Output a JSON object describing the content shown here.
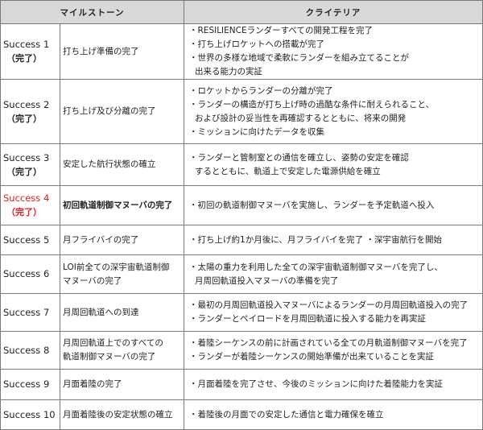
{
  "headers": {
    "milestone": "マイルストーン",
    "criteria": "クライテリア"
  },
  "accent_color": "#e0201b",
  "rows": [
    {
      "id": "Success 1",
      "status": "（完了）",
      "highlight": false,
      "name": [
        "打ち上げ準備の完了"
      ],
      "criteria": [
        {
          "text": "・RESILIENCEランダーすべての開発工程を完了",
          "cont": false
        },
        {
          "text": "・打ち上げロケットへの搭載が完了",
          "cont": false
        },
        {
          "text": "・世界の多様な地域で柔軟にランダーを組み立てることが",
          "cont": false
        },
        {
          "text": "出来る能力の実証",
          "cont": true
        }
      ]
    },
    {
      "id": "Success 2",
      "status": "（完了）",
      "highlight": false,
      "name": [
        "打ち上げ及び分離の完了"
      ],
      "criteria": [
        {
          "text": "・ロケットからランダーの分離が完了",
          "cont": false
        },
        {
          "text": "・ランダーの構造が打ち上げ時の過酷な条件に耐えられること、",
          "cont": false
        },
        {
          "text": "および設計の妥当性を再確認するとともに、将来の開発",
          "cont": true
        },
        {
          "text": "・ミッションに向けたデータを収集",
          "cont": false
        }
      ]
    },
    {
      "id": "Success 3",
      "status": "（完了）",
      "highlight": false,
      "name": [
        "安定した航行状態の確立"
      ],
      "criteria": [
        {
          "text": "・ランダーと管制室との通信を確立し、姿勢の安定を確認",
          "cont": false
        },
        {
          "text": "するとともに、軌道上で安定した電源供給を確立",
          "cont": true
        }
      ]
    },
    {
      "id": "Success 4",
      "status": "（完了）",
      "highlight": true,
      "name": [
        "初回軌道制御マヌーバの完了"
      ],
      "criteria": [
        {
          "text": "・初回の軌道制御マヌーバを実施し、ランダーを予定軌道へ投入",
          "cont": false
        }
      ]
    },
    {
      "id": "Success 5",
      "status": "",
      "highlight": false,
      "name": [
        "月フライバイの完了"
      ],
      "criteria": [
        {
          "text": "・打ち上げ約1か月後に、月フライバイを完了 ・深宇宙航行を開始",
          "cont": false
        }
      ]
    },
    {
      "id": "Success 6",
      "status": "",
      "highlight": false,
      "name": [
        "LOI前全ての深宇宙軌道制御",
        "マヌーバの完了"
      ],
      "criteria": [
        {
          "text": "・太陽の重力を利用した全ての深宇宙軌道制御マヌーバを完了し、",
          "cont": false
        },
        {
          "text": "月周回軌道投入マヌーバの準備を完了",
          "cont": true
        }
      ]
    },
    {
      "id": "Success 7",
      "status": "",
      "highlight": false,
      "name": [
        "月周回軌道への到達"
      ],
      "criteria": [
        {
          "text": "・最初の月周回軌道投入マヌーバによるランダーの月周回軌道投入の完了",
          "cont": false
        },
        {
          "text": "・ランダーとペイロードを月周回軌道に投入する能力を再実証",
          "cont": false
        }
      ]
    },
    {
      "id": "Success 8",
      "status": "",
      "highlight": false,
      "name": [
        "月周回軌道上でのすべての",
        "軌道制御マヌーバの完了"
      ],
      "criteria": [
        {
          "text": "・着陸シーケンスの前に計画されている全ての月軌道制御マヌーバを完了",
          "cont": false
        },
        {
          "text": "・ランダーが着陸シーケンスの開始準備が出来ていることを実証",
          "cont": false
        }
      ]
    },
    {
      "id": "Success 9",
      "status": "",
      "highlight": false,
      "name": [
        "月面着陸の完了"
      ],
      "criteria": [
        {
          "text": "・月面着陸を完了させ、今後のミッションに向けた着陸能力を実証",
          "cont": false
        }
      ]
    },
    {
      "id": "Success 10",
      "status": "",
      "highlight": false,
      "name": [
        "月面着陸後の安定状態の確立"
      ],
      "criteria": [
        {
          "text": "・着陸後の月面での安定した通信と電力確保を確立",
          "cont": false
        }
      ]
    }
  ]
}
